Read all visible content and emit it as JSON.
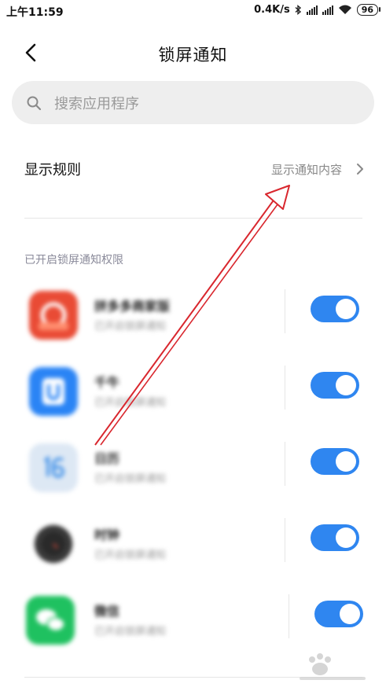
{
  "status_bar": {
    "time": "上午11:59",
    "speed": "0.4K/s",
    "battery": "96"
  },
  "header": {
    "title": "锁屏通知"
  },
  "search": {
    "placeholder": "搜索应用程序"
  },
  "rule": {
    "label": "显示规则",
    "value": "显示通知内容"
  },
  "section": {
    "title": "已开启锁屏通知权限"
  },
  "apps": [
    {
      "name": "拼多多商家版",
      "sub": "已开启锁屏通知",
      "enabled": true
    },
    {
      "name": "千牛",
      "sub": "已开启锁屏通知",
      "enabled": true
    },
    {
      "name": "日历",
      "sub": "已开启锁屏通知",
      "enabled": true
    },
    {
      "name": "时钟",
      "sub": "已开启锁屏通知",
      "enabled": true
    },
    {
      "name": "微信",
      "sub": "已开启锁屏通知",
      "enabled": true
    }
  ],
  "icons": {
    "back": "back-arrow-icon",
    "search": "search-icon",
    "chevron": "chevron-right-icon"
  },
  "colors": {
    "toggle_on": "#2f86f0",
    "annotation": "#d9272e"
  }
}
